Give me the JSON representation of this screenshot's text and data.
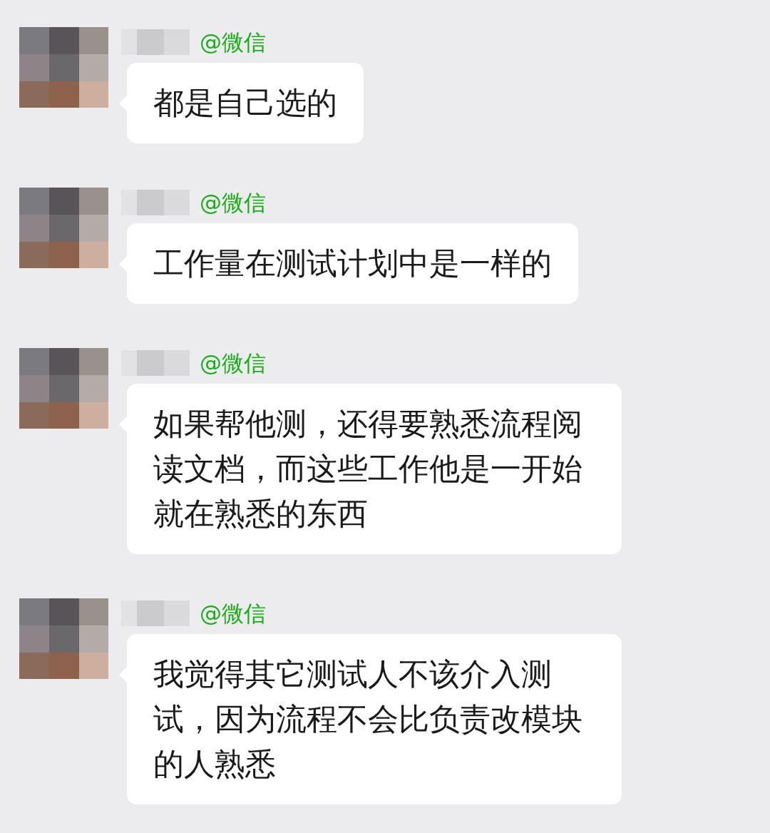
{
  "messages": [
    {
      "sender": "@微信",
      "text": "都是自己选的"
    },
    {
      "sender": "@微信",
      "text": "工作量在测试计划中是一样的"
    },
    {
      "sender": "@微信",
      "text": "如果帮他测，还得要熟悉流程阅读文档，而这些工作他是一开始就在熟悉的东西"
    },
    {
      "sender": "@微信",
      "text": "我觉得其它测试人不该介入测试，因为流程不会比负责改模块的人熟悉"
    }
  ]
}
